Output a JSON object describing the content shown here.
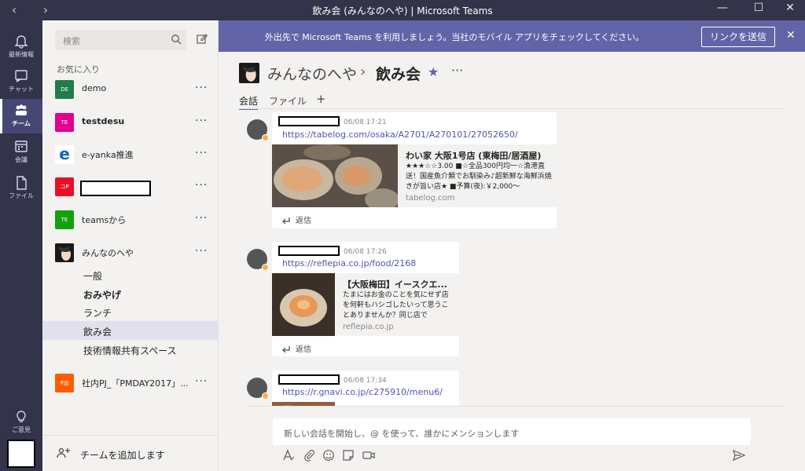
{
  "window": {
    "title": "飲み会 (みんなのへや) | Microsoft Teams",
    "back_glyph": "‹",
    "forward_glyph": "›",
    "minimize_glyph": "—",
    "maximize_glyph": "☐",
    "close_glyph": "✕"
  },
  "rail": {
    "items": [
      {
        "label": "最新情報",
        "icon": "bell-icon"
      },
      {
        "label": "チャット",
        "icon": "chat-icon"
      },
      {
        "label": "チーム",
        "icon": "teams-icon"
      },
      {
        "label": "会議",
        "icon": "calendar-icon"
      },
      {
        "label": "ファイル",
        "icon": "files-icon"
      }
    ],
    "feedback_label": "ご意見"
  },
  "sidebar": {
    "search_placeholder": "検索",
    "favorites_label": "お気に入り",
    "teams": [
      {
        "abbr": "DE",
        "name": "demo",
        "color": "#237b4b",
        "more": "···"
      },
      {
        "abbr": "TE",
        "name": "testdesu",
        "color": "#e3008c",
        "more": "···"
      },
      {
        "abbr": "e",
        "name": "e-yanka推進",
        "color": "#ffffff",
        "more": "···"
      },
      {
        "abbr": "コP",
        "name": "",
        "color": "#e81123",
        "more": "···"
      },
      {
        "abbr": "TE",
        "name": "teamsから",
        "color": "#13a10e",
        "more": "···"
      },
      {
        "abbr": "",
        "name": "みんなのへや",
        "color": "#222222",
        "more": "···"
      },
      {
        "abbr": "P出",
        "name": "社内PJ_「PMDAY2017」...",
        "color": "#ff5c00",
        "more": "···"
      }
    ],
    "channels": [
      {
        "name": "一般"
      },
      {
        "name": "おみやげ"
      },
      {
        "name": "ランチ"
      },
      {
        "name": "飲み会"
      },
      {
        "name": "技術情報共有スペース"
      }
    ],
    "add_team_label": "チームを追加します"
  },
  "banner": {
    "message": "外出先で Microsoft Teams を利用しましょう。当社のモバイル アプリをチェックしてください。",
    "button_label": "リンクを送信",
    "close_glyph": "✕"
  },
  "channel_header": {
    "team_name": "みんなのへや",
    "separator": "›",
    "channel_name": "飲み会",
    "star_glyph": "★",
    "more_glyph": "···",
    "tabs": [
      "会話",
      "ファイル",
      "+"
    ]
  },
  "messages": [
    {
      "time": "06/08 17:21",
      "url": "https://tabelog.com/osaka/A2701/A270101/27052650/",
      "preview_title": "わい家 大阪1号店 (東梅田/居酒屋)",
      "preview_desc": "★★★☆☆3.00 ■☆全品300円均一☆漁港直送！国産魚介類でお馴染み♪超新鮮な海鮮浜焼きが旨い店★ ■予算(夜):￥2,000～",
      "preview_domain": "tabelog.com",
      "reply_label": "返信"
    },
    {
      "time": "06/08 17:26",
      "url": "https://reflepia.co.jp/food/2168",
      "preview_title": "【大阪梅田】イースクエ...",
      "preview_desc": "たまにはお金のことを気にせず店を何軒もハシゴしたいって思うことありませんか？同じ店で",
      "preview_domain": "reflepia.co.jp",
      "reply_label": "返信"
    },
    {
      "time": "06/08 17:34",
      "url": "https://r.gnavi.co.jp/c275910/menu6/"
    }
  ],
  "compose": {
    "placeholder": "新しい会話を開始し、@ を使って、誰かにメンションします"
  }
}
